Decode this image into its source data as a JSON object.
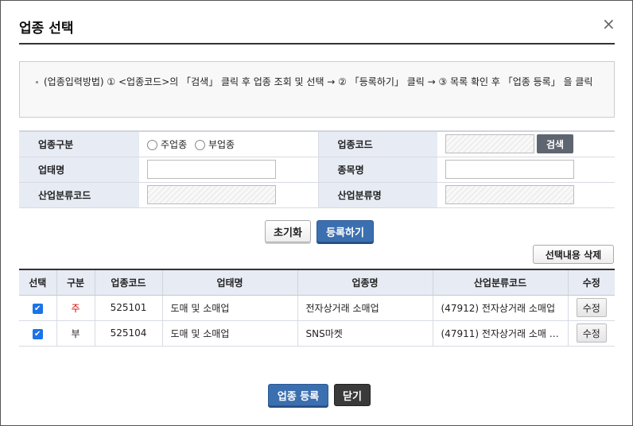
{
  "dialog": {
    "title": "업종 선택",
    "close": "×"
  },
  "notice": {
    "text": "(업종입력방법) ① <업종코드>의 「검색」 클릭 후 업종 조회 및 선택 → ② 「등록하기」 클릭 → ③ 목록 확인 후 「업종 등록」 을 클릭"
  },
  "form": {
    "type_label": "업종구분",
    "radio_main": "주업종",
    "radio_sub": "부업종",
    "code_label": "업종코드",
    "search": "검색",
    "biz_label": "업태명",
    "item_label": "종목명",
    "ind_code_label": "산업분류코드",
    "ind_name_label": "산업분류명"
  },
  "actions": {
    "reset": "초기화",
    "register": "등록하기",
    "delete_selected": "선택내용 삭제"
  },
  "grid": {
    "headers": [
      "선택",
      "구분",
      "업종코드",
      "업태명",
      "업종명",
      "산업분류코드",
      "수정"
    ],
    "rows": [
      {
        "checked": true,
        "type": "주",
        "code": "525101",
        "biz": "도매 및 소매업",
        "name": "전자상거래 소매업",
        "ind": "(47912) 전자상거래 소매업",
        "edit": "수정"
      },
      {
        "checked": true,
        "type": "부",
        "code": "525104",
        "biz": "도매 및 소매업",
        "name": "SNS마켓",
        "ind": "(47911) 전자상거래 소매 …",
        "edit": "수정"
      }
    ]
  },
  "footer": {
    "submit": "업종 등록",
    "close": "닫기"
  },
  "colors": {
    "accent": "#3b6fb0",
    "main_type": "#d00000"
  }
}
